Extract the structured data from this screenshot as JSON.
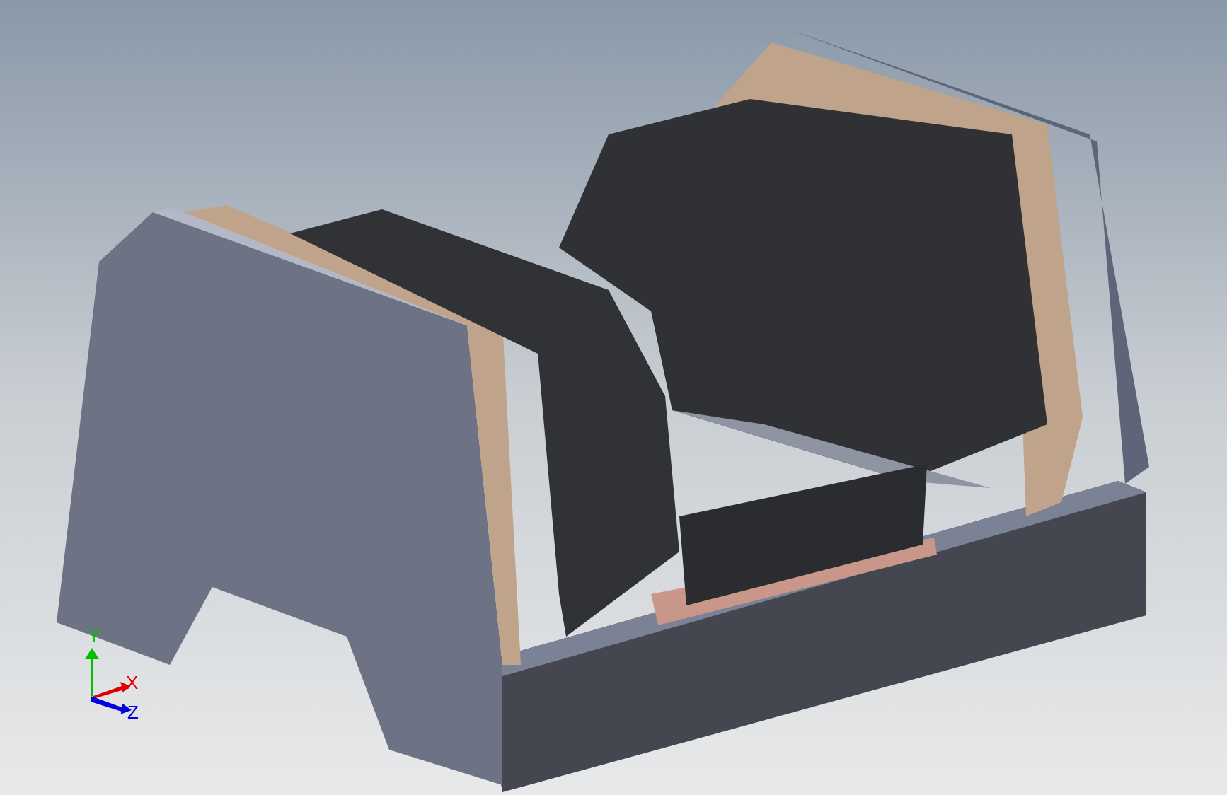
{
  "viewport": {
    "triad": {
      "axes": [
        {
          "kind": "y",
          "label": "Y",
          "color": "#00c000"
        },
        {
          "kind": "x",
          "label": "X",
          "color": "#e00000"
        },
        {
          "kind": "z",
          "label": "Z",
          "color": "#0000e0"
        }
      ]
    }
  }
}
